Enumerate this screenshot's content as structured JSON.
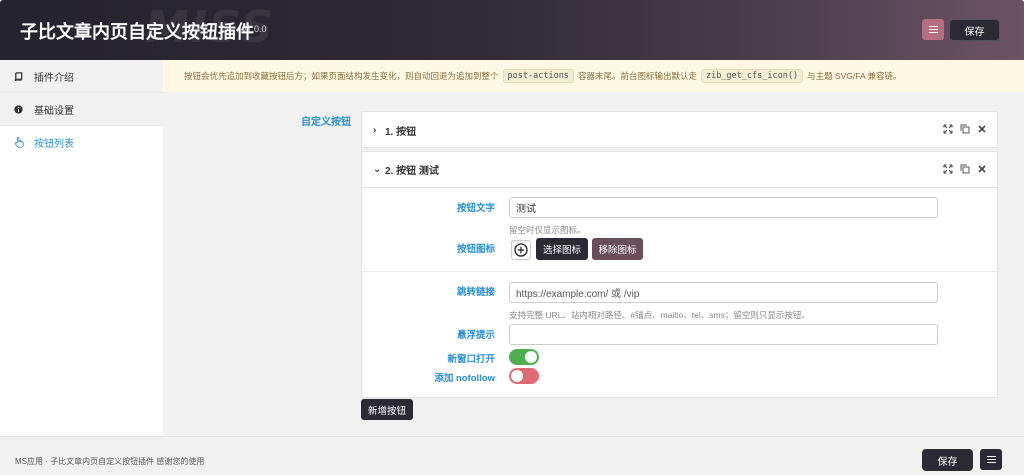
{
  "header": {
    "title": "子比文章内页自定义按钮插件",
    "version": "v1.0.0",
    "watermark": "MISS",
    "save_label": "保存",
    "menu_icon": "list-icon"
  },
  "sidebar": {
    "items": [
      {
        "label": "插件介绍",
        "icon": "book-icon",
        "active": false
      },
      {
        "label": "基础设置",
        "icon": "info-icon",
        "active": false
      },
      {
        "label": "按钮列表",
        "icon": "hand-pointer-icon",
        "active": true
      }
    ]
  },
  "notice": {
    "text_1": "按钮会优先追加到收藏按钮后方；如果页面结构发生变化，则自动回退为追加到整个",
    "code_1": "post-actions",
    "text_2": "容器末尾。前台图标输出默认走",
    "code_2": "zib_get_cfs_icon()",
    "text_3": "与主题 SVG/FA 兼容链。"
  },
  "main": {
    "field_label": "自定义按钮",
    "groups": [
      {
        "title": "1. 按钮",
        "expanded": false
      },
      {
        "title": "2. 按钮 测试",
        "expanded": true
      }
    ],
    "form": {
      "button_text_label": "按钮文字",
      "button_text_value": "测试",
      "button_text_help": "留空时仅显示图标。",
      "button_icon_label": "按钮图标",
      "select_icon_label": "选择图标",
      "remove_icon_label": "移除图标",
      "link_label": "跳转链接",
      "link_placeholder": "https://example.com/ 或 /vip",
      "link_help": "支持完整 URL、站内相对路径、#锚点、mailto、tel、sms；留空则只显示按钮。",
      "tooltip_label": "悬浮提示",
      "tooltip_value": "",
      "new_window_label": "新窗口打开",
      "new_window_on": true,
      "nofollow_label": "添加 nofollow",
      "nofollow_on": false
    },
    "add_button_label": "新增按钮"
  },
  "footer": {
    "text": "MS应用 · 子比文章内页自定义按钮插件 感谢您的使用",
    "save_label": "保存"
  },
  "colors": {
    "accent": "#2a8fd0",
    "dark_button": "#2c2a34",
    "toggle_on": "#4caf50",
    "toggle_off": "#e06b72",
    "notice_bg": "#fcf8e3"
  }
}
